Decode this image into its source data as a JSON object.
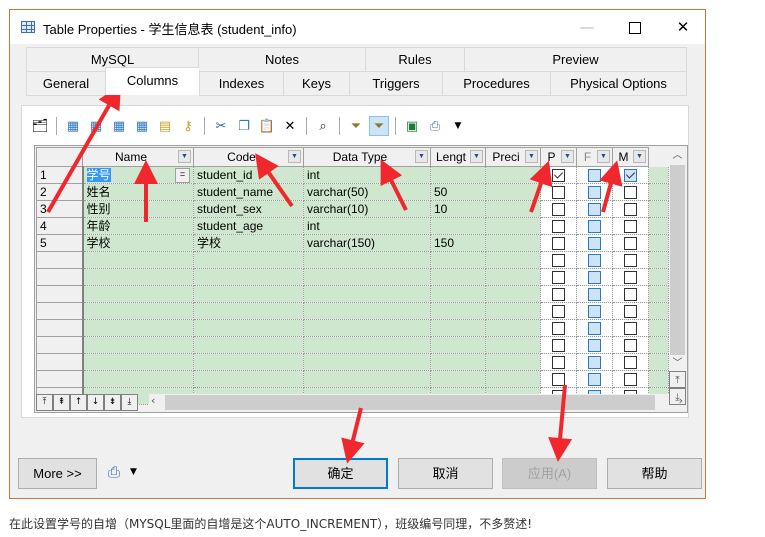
{
  "window": {
    "title": "Table Properties - 学生信息表 (student_info)",
    "controls": {
      "minimize": "—",
      "maximize": "□",
      "close": "✕"
    }
  },
  "tabs": {
    "top_row": [
      {
        "label": "MySQL"
      },
      {
        "label": "Notes"
      },
      {
        "label": "Rules"
      },
      {
        "label": "Preview"
      }
    ],
    "bottom_row": [
      {
        "label": "General"
      },
      {
        "label": "Columns",
        "active": true
      },
      {
        "label": "Indexes"
      },
      {
        "label": "Keys"
      },
      {
        "label": "Triggers"
      },
      {
        "label": "Procedures"
      },
      {
        "label": "Physical Options"
      }
    ]
  },
  "toolbar": {
    "icons": [
      "properties-icon",
      "insert-row-icon",
      "add-row-icon",
      "add-columns-icon",
      "reuse-columns-icon",
      "new-domain-icon",
      "key-icon",
      "cut-icon",
      "copy-icon",
      "paste-icon",
      "delete-icon",
      "find-icon",
      "filter-icon",
      "filter-enabled-icon",
      "excel-export-icon",
      "print-icon",
      "dropdown-icon"
    ]
  },
  "grid": {
    "columns": [
      "Name",
      "Code",
      "Data Type",
      "Lengt",
      "Preci",
      "P",
      "F",
      "M"
    ],
    "rows": [
      {
        "num": "1",
        "name": "学号",
        "code": "student_id",
        "type": "int",
        "length": "",
        "precision": "",
        "P": true,
        "F": false,
        "M": true
      },
      {
        "num": "2",
        "name": "姓名",
        "code": "student_name",
        "type": "varchar(50)",
        "length": "50",
        "precision": "",
        "P": false,
        "F": false,
        "M": false
      },
      {
        "num": "3",
        "name": "性别",
        "code": "student_sex",
        "type": "varchar(10)",
        "length": "10",
        "precision": "",
        "P": false,
        "F": false,
        "M": false
      },
      {
        "num": "4",
        "name": "年龄",
        "code": "student_age",
        "type": "int",
        "length": "",
        "precision": "",
        "P": false,
        "F": false,
        "M": false
      },
      {
        "num": "5",
        "name": "学校",
        "code": "学校",
        "type": "varchar(150)",
        "length": "150",
        "precision": "",
        "P": false,
        "F": false,
        "M": false
      }
    ],
    "empty_rows": 9,
    "name_cell_button": "="
  },
  "footer": {
    "more_label": "More >>",
    "ok_label": "确定",
    "cancel_label": "取消",
    "apply_label": "应用(A)",
    "help_label": "帮助"
  },
  "caption": "在此设置学号的自增（MYSQL里面的自增是这个AUTO_INCREMENT），班级编号同理，不多赘述!"
}
